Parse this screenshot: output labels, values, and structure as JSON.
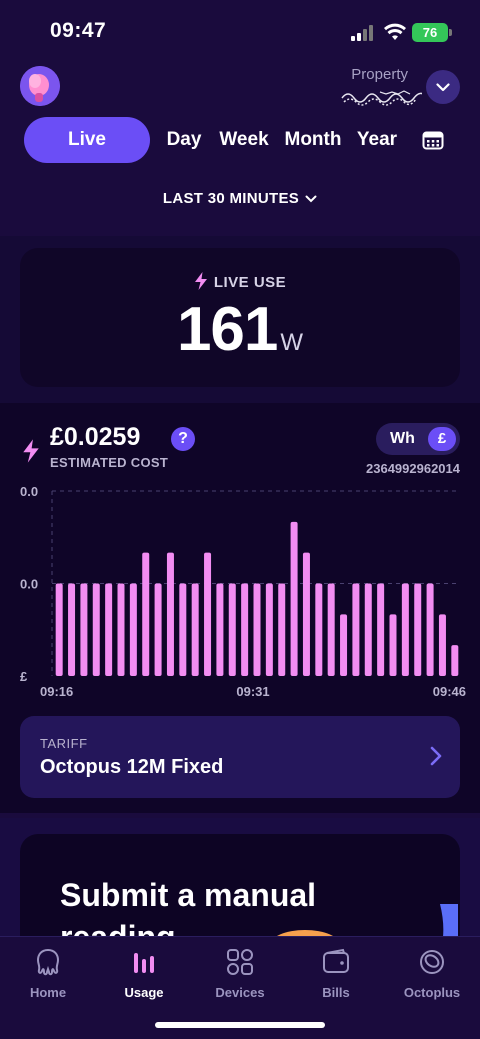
{
  "status_bar": {
    "time": "09:47",
    "battery": "76"
  },
  "header": {
    "property_label": "Property"
  },
  "tabs": [
    {
      "label": "Live"
    },
    {
      "label": "Day"
    },
    {
      "label": "Week"
    },
    {
      "label": "Month"
    },
    {
      "label": "Year"
    }
  ],
  "range": {
    "label": "LAST 30 MINUTES"
  },
  "live": {
    "label": "LIVE USE",
    "value": "161",
    "unit": "W"
  },
  "cost": {
    "value": "£0.0259",
    "label": "ESTIMATED COST",
    "help": "?",
    "unit_wh": "Wh",
    "unit_gbp": "£",
    "meter_id": "2364992962014"
  },
  "chart_data": {
    "type": "bar",
    "y_tick_labels": [
      "0.0",
      "0.0",
      "£"
    ],
    "x_tick_labels": [
      "09:16",
      "09:31",
      "09:46"
    ],
    "values": [
      3,
      3,
      3,
      3,
      3,
      3,
      3,
      4,
      3,
      4,
      3,
      3,
      4,
      3,
      3,
      3,
      3,
      3,
      3,
      5,
      4,
      3,
      3,
      2,
      3,
      3,
      3,
      2,
      3,
      3,
      3,
      2,
      1
    ],
    "ylim": [
      0,
      6
    ],
    "bar_color": "#f28df2",
    "grid": true
  },
  "tariff": {
    "label": "TARIFF",
    "name": "Octopus 12M Fixed"
  },
  "promo": {
    "title": "Submit a manual reading"
  },
  "nav": [
    {
      "label": "Home",
      "icon": "octopus-icon"
    },
    {
      "label": "Usage",
      "icon": "usage-bars-icon"
    },
    {
      "label": "Devices",
      "icon": "devices-grid-icon"
    },
    {
      "label": "Bills",
      "icon": "wallet-icon"
    },
    {
      "label": "Octoplus",
      "icon": "octoplus-icon"
    }
  ],
  "colors": {
    "accent": "#6b4ef6",
    "background": "#1a0b3d",
    "bar": "#f28df2",
    "lightning": "#f28df2"
  }
}
